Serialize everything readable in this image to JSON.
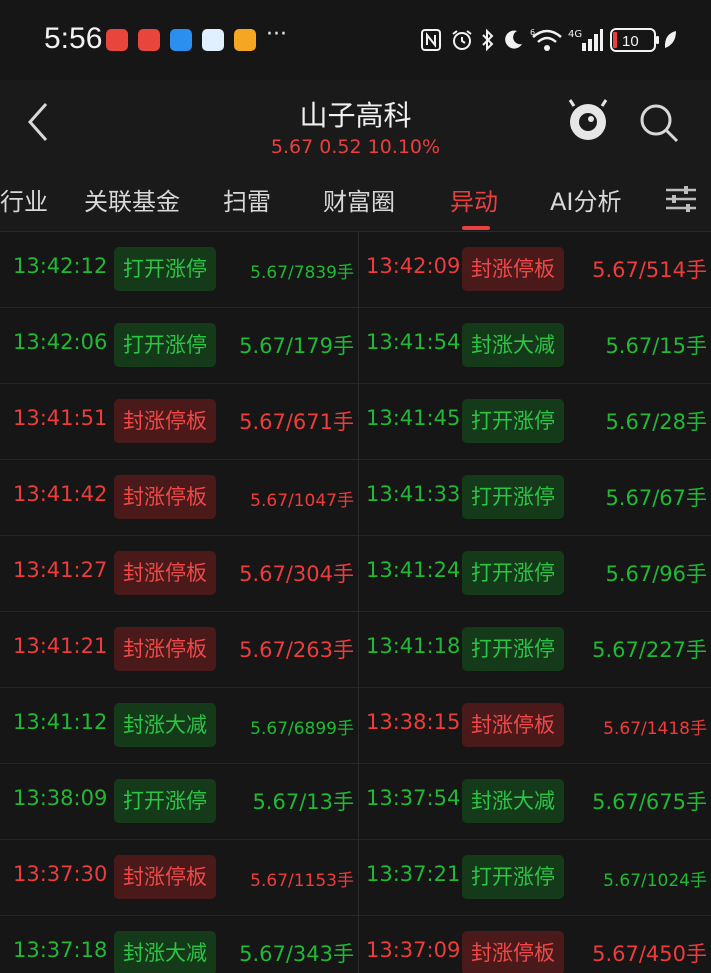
{
  "status_bar": {
    "time": "5:56",
    "battery": "10",
    "network": "4G",
    "sim_label": "6"
  },
  "header": {
    "title": "山子高科",
    "quote": "5.67 0.52 10.10%"
  },
  "tabs": [
    {
      "label": "行业",
      "active": false
    },
    {
      "label": "关联基金",
      "active": false
    },
    {
      "label": "扫雷",
      "active": false
    },
    {
      "label": "财富圈",
      "active": false
    },
    {
      "label": "异动",
      "active": true
    },
    {
      "label": "AI分析",
      "active": false
    }
  ],
  "colors": {
    "up": "#ee3b3b",
    "down": "#1fb935",
    "background": "#161616"
  },
  "events": [
    [
      {
        "time": "13:42:12",
        "tag": "打开涨停",
        "value": "5.67/7839手",
        "color": "green",
        "small": true
      },
      {
        "time": "13:42:09",
        "tag": "封涨停板",
        "value": "5.67/514手",
        "color": "red",
        "small": false
      }
    ],
    [
      {
        "time": "13:42:06",
        "tag": "打开涨停",
        "value": "5.67/179手",
        "color": "green",
        "small": false
      },
      {
        "time": "13:41:54",
        "tag": "封涨大减",
        "value": "5.67/15手",
        "color": "green",
        "small": false
      }
    ],
    [
      {
        "time": "13:41:51",
        "tag": "封涨停板",
        "value": "5.67/671手",
        "color": "red",
        "small": false
      },
      {
        "time": "13:41:45",
        "tag": "打开涨停",
        "value": "5.67/28手",
        "color": "green",
        "small": false
      }
    ],
    [
      {
        "time": "13:41:42",
        "tag": "封涨停板",
        "value": "5.67/1047手",
        "color": "red",
        "small": true
      },
      {
        "time": "13:41:33",
        "tag": "打开涨停",
        "value": "5.67/67手",
        "color": "green",
        "small": false
      }
    ],
    [
      {
        "time": "13:41:27",
        "tag": "封涨停板",
        "value": "5.67/304手",
        "color": "red",
        "small": false
      },
      {
        "time": "13:41:24",
        "tag": "打开涨停",
        "value": "5.67/96手",
        "color": "green",
        "small": false
      }
    ],
    [
      {
        "time": "13:41:21",
        "tag": "封涨停板",
        "value": "5.67/263手",
        "color": "red",
        "small": false
      },
      {
        "time": "13:41:18",
        "tag": "打开涨停",
        "value": "5.67/227手",
        "color": "green",
        "small": false
      }
    ],
    [
      {
        "time": "13:41:12",
        "tag": "封涨大减",
        "value": "5.67/6899手",
        "color": "green",
        "small": true
      },
      {
        "time": "13:38:15",
        "tag": "封涨停板",
        "value": "5.67/1418手",
        "color": "red",
        "small": true
      }
    ],
    [
      {
        "time": "13:38:09",
        "tag": "打开涨停",
        "value": "5.67/13手",
        "color": "green",
        "small": false
      },
      {
        "time": "13:37:54",
        "tag": "封涨大减",
        "value": "5.67/675手",
        "color": "green",
        "small": false
      }
    ],
    [
      {
        "time": "13:37:30",
        "tag": "封涨停板",
        "value": "5.67/1153手",
        "color": "red",
        "small": true
      },
      {
        "time": "13:37:21",
        "tag": "打开涨停",
        "value": "5.67/1024手",
        "color": "green",
        "small": true
      }
    ],
    [
      {
        "time": "13:37:18",
        "tag": "封涨大减",
        "value": "5.67/343手",
        "color": "green",
        "small": false
      },
      {
        "time": "13:37:09",
        "tag": "封涨停板",
        "value": "5.67/450手",
        "color": "red",
        "small": false
      }
    ]
  ]
}
